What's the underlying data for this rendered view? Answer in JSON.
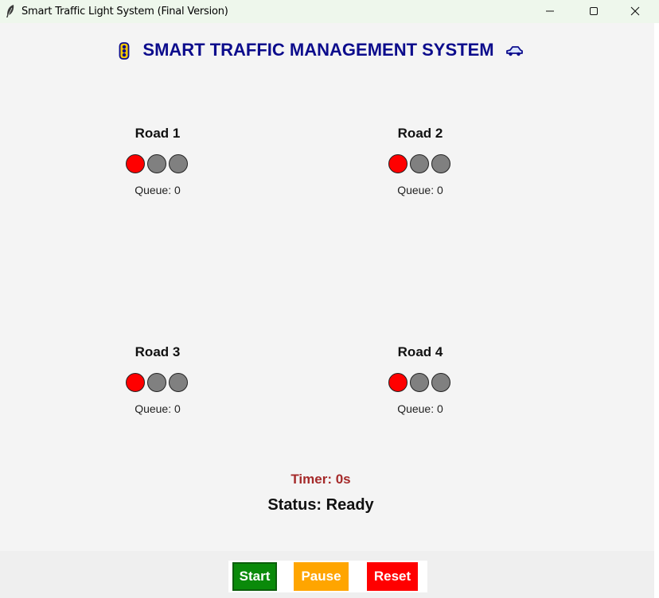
{
  "window": {
    "title": "Smart Traffic Light System (Final Version)"
  },
  "header": {
    "title": "SMART TRAFFIC MANAGEMENT SYSTEM",
    "left_icon": "traffic-light-icon",
    "right_icon": "car-icon",
    "title_color": "#0c0c8c"
  },
  "roads": [
    {
      "name": "Road 1",
      "queue": "Queue: 0",
      "active_light": "red"
    },
    {
      "name": "Road 2",
      "queue": "Queue: 0",
      "active_light": "red"
    },
    {
      "name": "Road 3",
      "queue": "Queue: 0",
      "active_light": "red"
    },
    {
      "name": "Road 4",
      "queue": "Queue: 0",
      "active_light": "red"
    }
  ],
  "light_colors": {
    "red": "#ff0000",
    "off": "#808080"
  },
  "timer": "Timer: 0s",
  "status": "Status: Ready",
  "controls": {
    "start_label": "Start",
    "pause_label": "Pause",
    "reset_label": "Reset",
    "start_color": "#0a8a0a",
    "pause_color": "#ffa500",
    "reset_color": "#ff0000"
  }
}
